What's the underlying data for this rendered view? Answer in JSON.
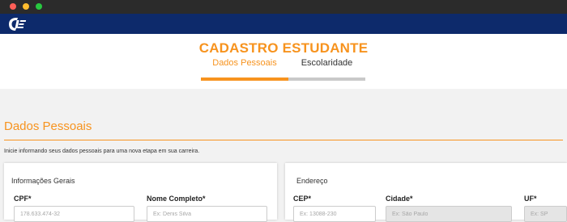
{
  "window": {
    "controls": [
      "close",
      "minimize",
      "maximize"
    ]
  },
  "brand": {
    "logo_icon": "ciee-logo-icon",
    "primary_color": "#0d2a6b",
    "accent_color": "#f7931e"
  },
  "header": {
    "title": "CADASTRO ESTUDANTE",
    "steps": [
      {
        "label": "Dados Pessoais",
        "active": true
      },
      {
        "label": "Escolaridade",
        "active": false
      }
    ]
  },
  "section": {
    "title": "Dados Pessoais",
    "intro": "Inicie informando seus dados pessoais para uma nova etapa em sua carreira."
  },
  "general_info": {
    "title": "Informações Gerais",
    "fields": [
      {
        "label": "CPF*",
        "placeholder": "178.633.474-32"
      },
      {
        "label": "Nome Completo*",
        "placeholder": "Ex: Denis Silva"
      }
    ]
  },
  "address": {
    "title": "Endereço",
    "fields": [
      {
        "label": "CEP*",
        "placeholder": "Ex: 13088-230"
      },
      {
        "label": "Cidade*",
        "placeholder": "Ex: São Paulo"
      },
      {
        "label": "UF*",
        "placeholder": "Ex: SP"
      }
    ]
  }
}
